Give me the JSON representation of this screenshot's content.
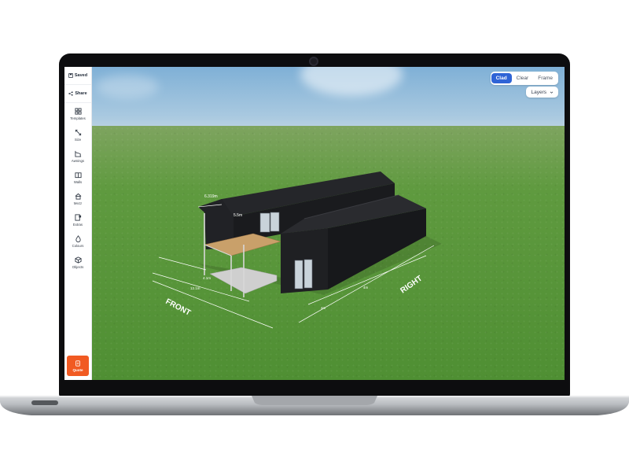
{
  "toolbar": {
    "saved_label": "Saved",
    "share_label": "Share",
    "quote_label": "Quote"
  },
  "sidebar": {
    "items": [
      {
        "label": "Templates",
        "icon": "grid-icon"
      },
      {
        "label": "Size",
        "icon": "resize-icon"
      },
      {
        "label": "Awnings",
        "icon": "awning-icon"
      },
      {
        "label": "Walls",
        "icon": "walls-icon"
      },
      {
        "label": "Mezz",
        "icon": "home-icon"
      },
      {
        "label": "Extras",
        "icon": "extras-icon"
      },
      {
        "label": "Colours",
        "icon": "droplet-icon"
      },
      {
        "label": "Objects",
        "icon": "cube-icon"
      }
    ]
  },
  "view_modes": {
    "options": [
      "Clad",
      "Clear",
      "Frame"
    ],
    "selected": "Clad"
  },
  "layers_label": "Layers",
  "scene": {
    "side_labels": {
      "front": "FRONT",
      "right": "RIGHT"
    },
    "dimensions": {
      "top_width": "6.319m",
      "height": "5.5m",
      "front_a": "12.1m",
      "front_b": "4.1m",
      "right_a": "4m",
      "right_b": "4m"
    }
  },
  "colors": {
    "accent_blue": "#2f64d6",
    "quote_orange": "#f15a22",
    "building_cladding": "#1e1e21",
    "grass": "#5f9a3f"
  }
}
